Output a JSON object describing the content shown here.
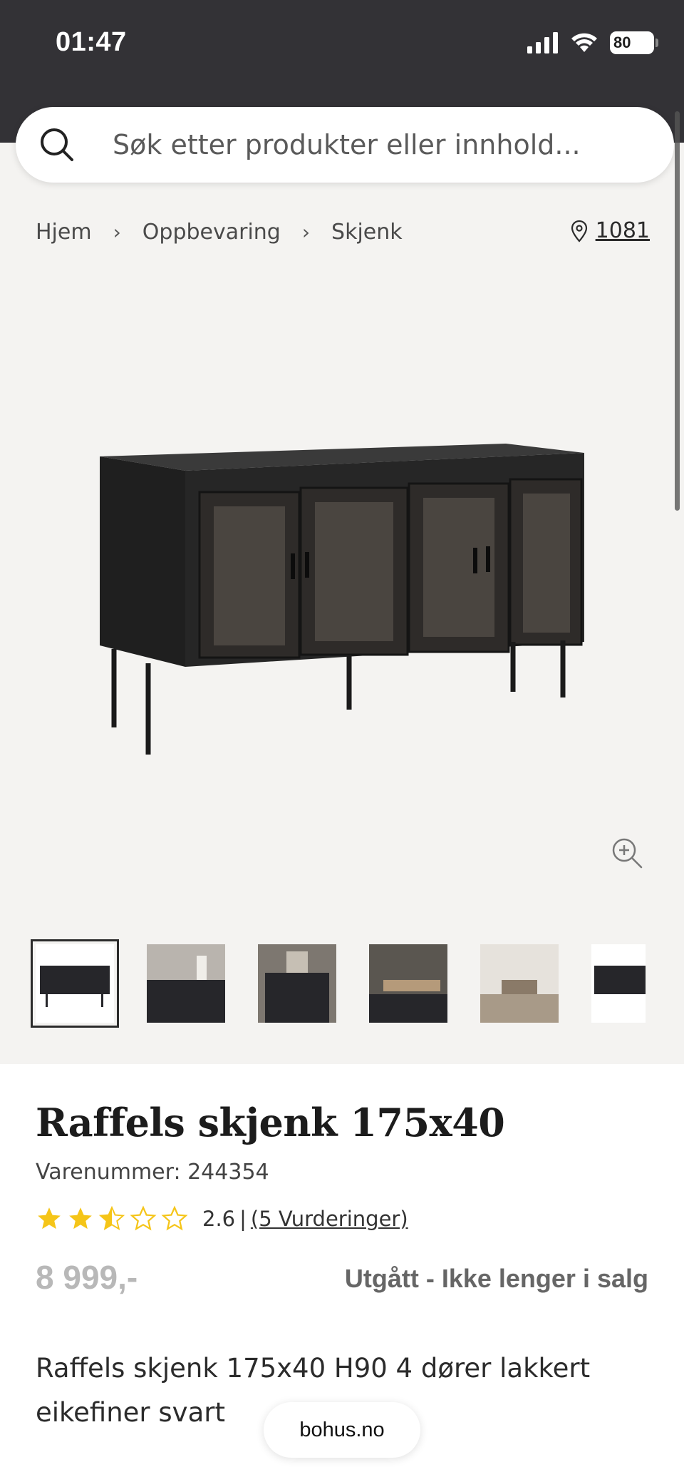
{
  "status_bar": {
    "time": "01:47",
    "battery": "80"
  },
  "search": {
    "placeholder": "Søk etter produkter eller innhold..."
  },
  "breadcrumb": {
    "items": [
      "Hjem",
      "Oppbevaring",
      "Skjenk"
    ]
  },
  "location": {
    "postcode": "1081"
  },
  "product": {
    "title": "Raffels skjenk 175x40",
    "sku": "Varenummer: 244354",
    "rating": {
      "value": "2.6",
      "out_of": 5,
      "separator": "|",
      "reviews_label": "(5 Vurderinger)"
    },
    "price": "8 999,-",
    "availability": "Utgått - Ikke lenger i salg",
    "description": "Raffels skjenk 175x40 H90 4 dører lakkert eikefiner svart"
  },
  "thumbnails": {
    "count": 6,
    "active_index": 0
  },
  "footer": {
    "site_label": "bohus.no"
  },
  "colors": {
    "header": "#333236",
    "page_bg": "#f4f3f1",
    "star": "#f5c518",
    "price_muted": "#b8b8b8"
  },
  "icons": [
    "search-icon",
    "chevron-right-icon",
    "location-pin-icon",
    "zoom-in-icon",
    "star-icon"
  ]
}
